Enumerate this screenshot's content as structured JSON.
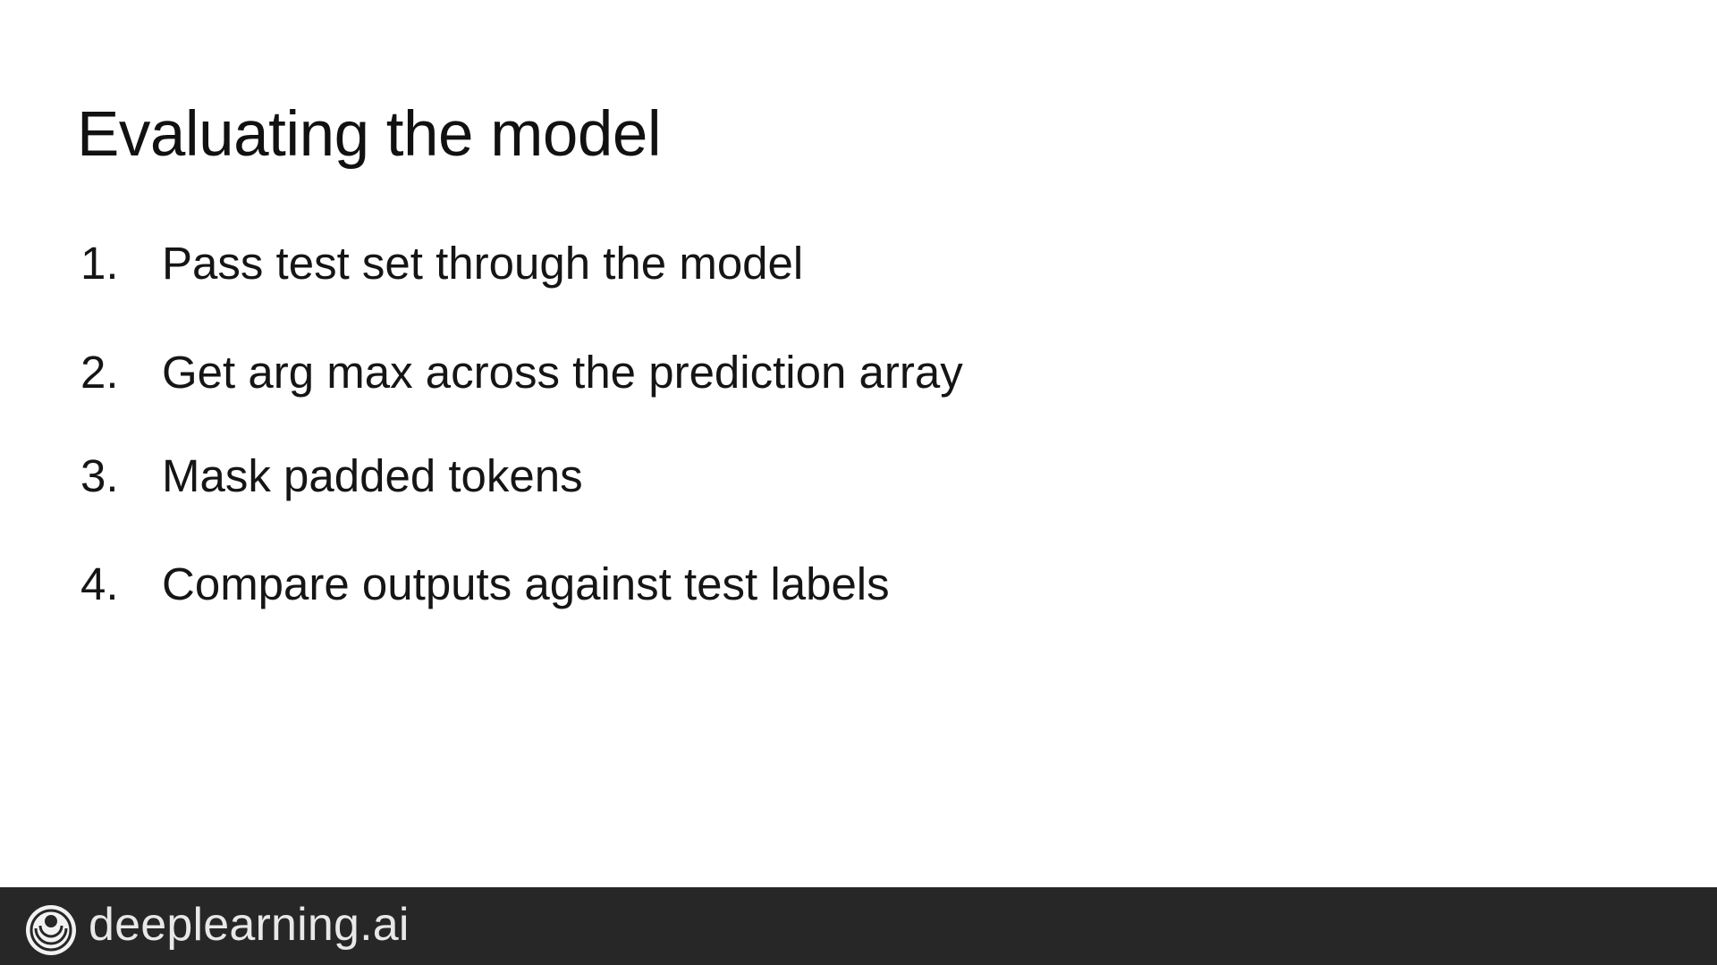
{
  "slide": {
    "title": "Evaluating the model",
    "steps": [
      {
        "number": "1.",
        "text": "Pass test set through the model"
      },
      {
        "number": "2.",
        "text": "Get arg max across the prediction array"
      },
      {
        "number": "3.",
        "text": "Mask padded tokens"
      },
      {
        "number": "4.",
        "text": "Compare outputs against test labels"
      }
    ]
  },
  "footer": {
    "brand_name": "deeplearning.ai",
    "logo_icon": "deeplearning-logo-icon",
    "background_color": "#272727",
    "text_color": "#e8e8e8"
  }
}
